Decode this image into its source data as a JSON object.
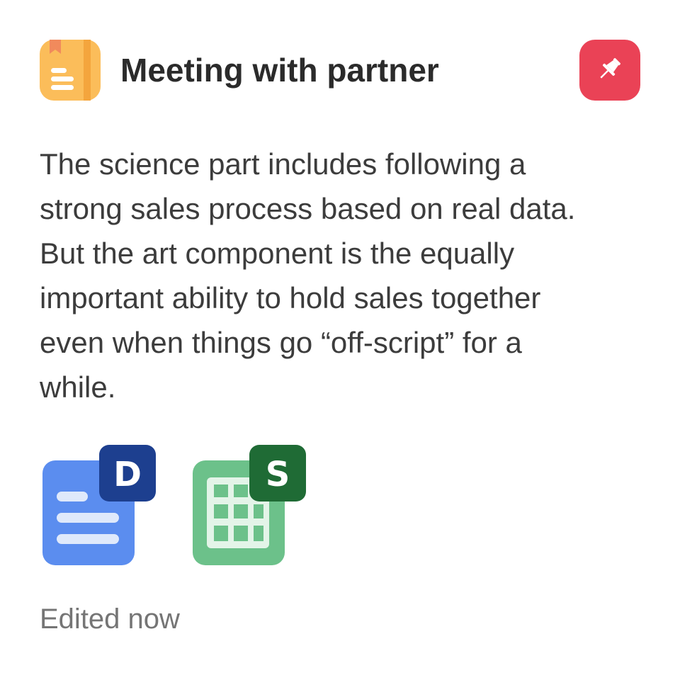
{
  "note": {
    "title": "Meeting with partner",
    "app_icon": "notes-icon",
    "pin_icon": "pin-icon",
    "pin_color": "#ea4256",
    "body": "The science part includes following a\nstrong sales process based on real data.\nBut the art component is the equally\nimportant ability to hold sales together\neven when things go “off-script” for a\nwhile.",
    "attachments": [
      {
        "type": "document",
        "badge": "D",
        "icon": "document-icon",
        "color": "#5b8def"
      },
      {
        "type": "spreadsheet",
        "badge": "S",
        "icon": "spreadsheet-icon",
        "color": "#6cc18a"
      }
    ],
    "status": "Edited now"
  }
}
